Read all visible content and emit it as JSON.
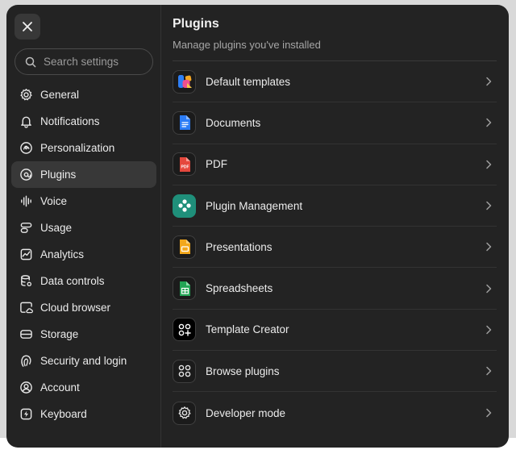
{
  "sidebar": {
    "search_placeholder": "Search settings",
    "items": [
      {
        "label": "General",
        "icon": "gear-icon"
      },
      {
        "label": "Notifications",
        "icon": "bell-icon"
      },
      {
        "label": "Personalization",
        "icon": "personalization-icon"
      },
      {
        "label": "Plugins",
        "icon": "plugins-icon",
        "active": true
      },
      {
        "label": "Voice",
        "icon": "voice-wave-icon"
      },
      {
        "label": "Usage",
        "icon": "usage-icon"
      },
      {
        "label": "Analytics",
        "icon": "analytics-icon"
      },
      {
        "label": "Data controls",
        "icon": "database-gear-icon"
      },
      {
        "label": "Cloud browser",
        "icon": "cloud-browser-icon"
      },
      {
        "label": "Storage",
        "icon": "storage-icon"
      },
      {
        "label": "Security and login",
        "icon": "security-icon"
      },
      {
        "label": "Account",
        "icon": "account-icon"
      },
      {
        "label": "Keyboard",
        "icon": "keyboard-bolt-icon"
      }
    ]
  },
  "main": {
    "title": "Plugins",
    "subtitle": "Manage plugins you've installed",
    "plugins": [
      {
        "label": "Default templates",
        "icon": "default-templates-icon"
      },
      {
        "label": "Documents",
        "icon": "documents-icon"
      },
      {
        "label": "PDF",
        "icon": "pdf-icon",
        "badge": "PDF"
      },
      {
        "label": "Plugin Management",
        "icon": "plugin-management-icon"
      },
      {
        "label": "Presentations",
        "icon": "presentations-icon"
      },
      {
        "label": "Spreadsheets",
        "icon": "spreadsheets-icon"
      },
      {
        "label": "Template Creator",
        "icon": "template-creator-icon"
      },
      {
        "label": "Browse plugins",
        "icon": "browse-plugins-icon"
      },
      {
        "label": "Developer mode",
        "icon": "developer-gear-icon"
      }
    ]
  },
  "colors": {
    "modal_bg": "#232323",
    "active_item": "#383838",
    "text": "#ececec",
    "muted": "#a6a6a6"
  }
}
